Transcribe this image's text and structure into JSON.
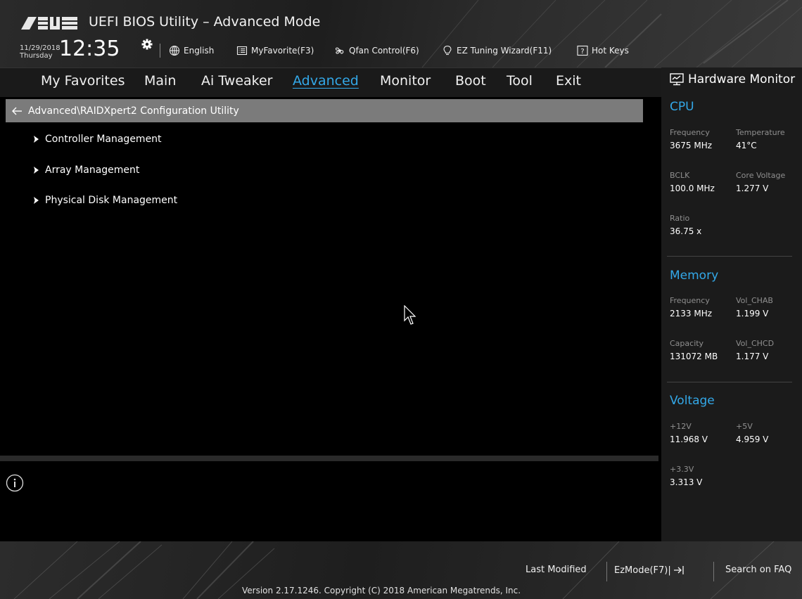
{
  "header": {
    "title": "UEFI BIOS Utility – Advanced Mode",
    "date": "11/29/2018",
    "day": "Thursday",
    "time": "12:35",
    "toolbar": {
      "language": "English",
      "favorite": "MyFavorite(F3)",
      "qfan": "Qfan Control(F6)",
      "ez_tuning": "EZ Tuning Wizard(F11)",
      "hot_keys": "Hot Keys"
    }
  },
  "nav": {
    "tabs": [
      "My Favorites",
      "Main",
      "Ai Tweaker",
      "Advanced",
      "Monitor",
      "Boot",
      "Tool",
      "Exit"
    ],
    "active": "Advanced"
  },
  "main": {
    "breadcrumb": "Advanced\\RAIDXpert2 Configuration Utility",
    "items": [
      "Controller Management",
      "Array Management",
      "Physical Disk Management"
    ]
  },
  "hardware_monitor": {
    "title": "Hardware Monitor",
    "cpu": {
      "title": "CPU",
      "frequency_label": "Frequency",
      "frequency": "3675 MHz",
      "temperature_label": "Temperature",
      "temperature": "41°C",
      "bclk_label": "BCLK",
      "bclk": "100.0 MHz",
      "core_voltage_label": "Core Voltage",
      "core_voltage": "1.277 V",
      "ratio_label": "Ratio",
      "ratio": "36.75 x"
    },
    "memory": {
      "title": "Memory",
      "frequency_label": "Frequency",
      "frequency": "2133 MHz",
      "vol_chab_label": "Vol_CHAB",
      "vol_chab": "1.199 V",
      "capacity_label": "Capacity",
      "capacity": "131072 MB",
      "vol_chcd_label": "Vol_CHCD",
      "vol_chcd": "1.177 V"
    },
    "voltage": {
      "title": "Voltage",
      "v12_label": "+12V",
      "v12": "11.968 V",
      "v5_label": "+5V",
      "v5": "4.959 V",
      "v33_label": "+3.3V",
      "v33": "3.313 V"
    }
  },
  "footer": {
    "last_modified": "Last Modified",
    "ezmode": "EzMode(F7)|",
    "search_faq": "Search on FAQ",
    "version": "Version 2.17.1246. Copyright (C) 2018 American Megatrends, Inc."
  },
  "colors": {
    "accent": "#33a8e8",
    "breadcrumb_bg": "#7b7b7b",
    "sidebar_bg": "#1b1b1b"
  }
}
